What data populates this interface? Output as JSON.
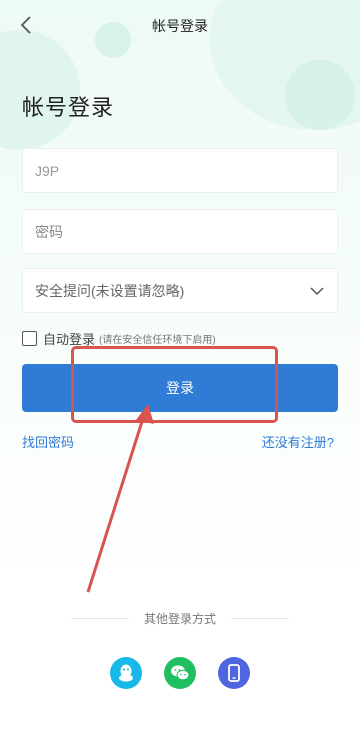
{
  "header": {
    "title": "帐号登录"
  },
  "page": {
    "title": "帐号登录"
  },
  "form": {
    "account_value": "J9P",
    "password_placeholder": "密码",
    "security_question": "安全提问(未设置请忽略)",
    "auto_login_label": "自动登录",
    "auto_login_hint": "(请在安全信任环境下启用)",
    "login_button": "登录",
    "forgot_link": "找回密码",
    "register_link": "还没有注册?"
  },
  "other_login": {
    "label": "其他登录方式",
    "methods": [
      "qq-icon",
      "wechat-icon",
      "phone-icon"
    ]
  },
  "colors": {
    "accent": "#2f7bd6",
    "highlight": "#d9534f",
    "qq": "#18b8e8",
    "wechat": "#1fbe5f",
    "phone": "#4f66e0"
  }
}
